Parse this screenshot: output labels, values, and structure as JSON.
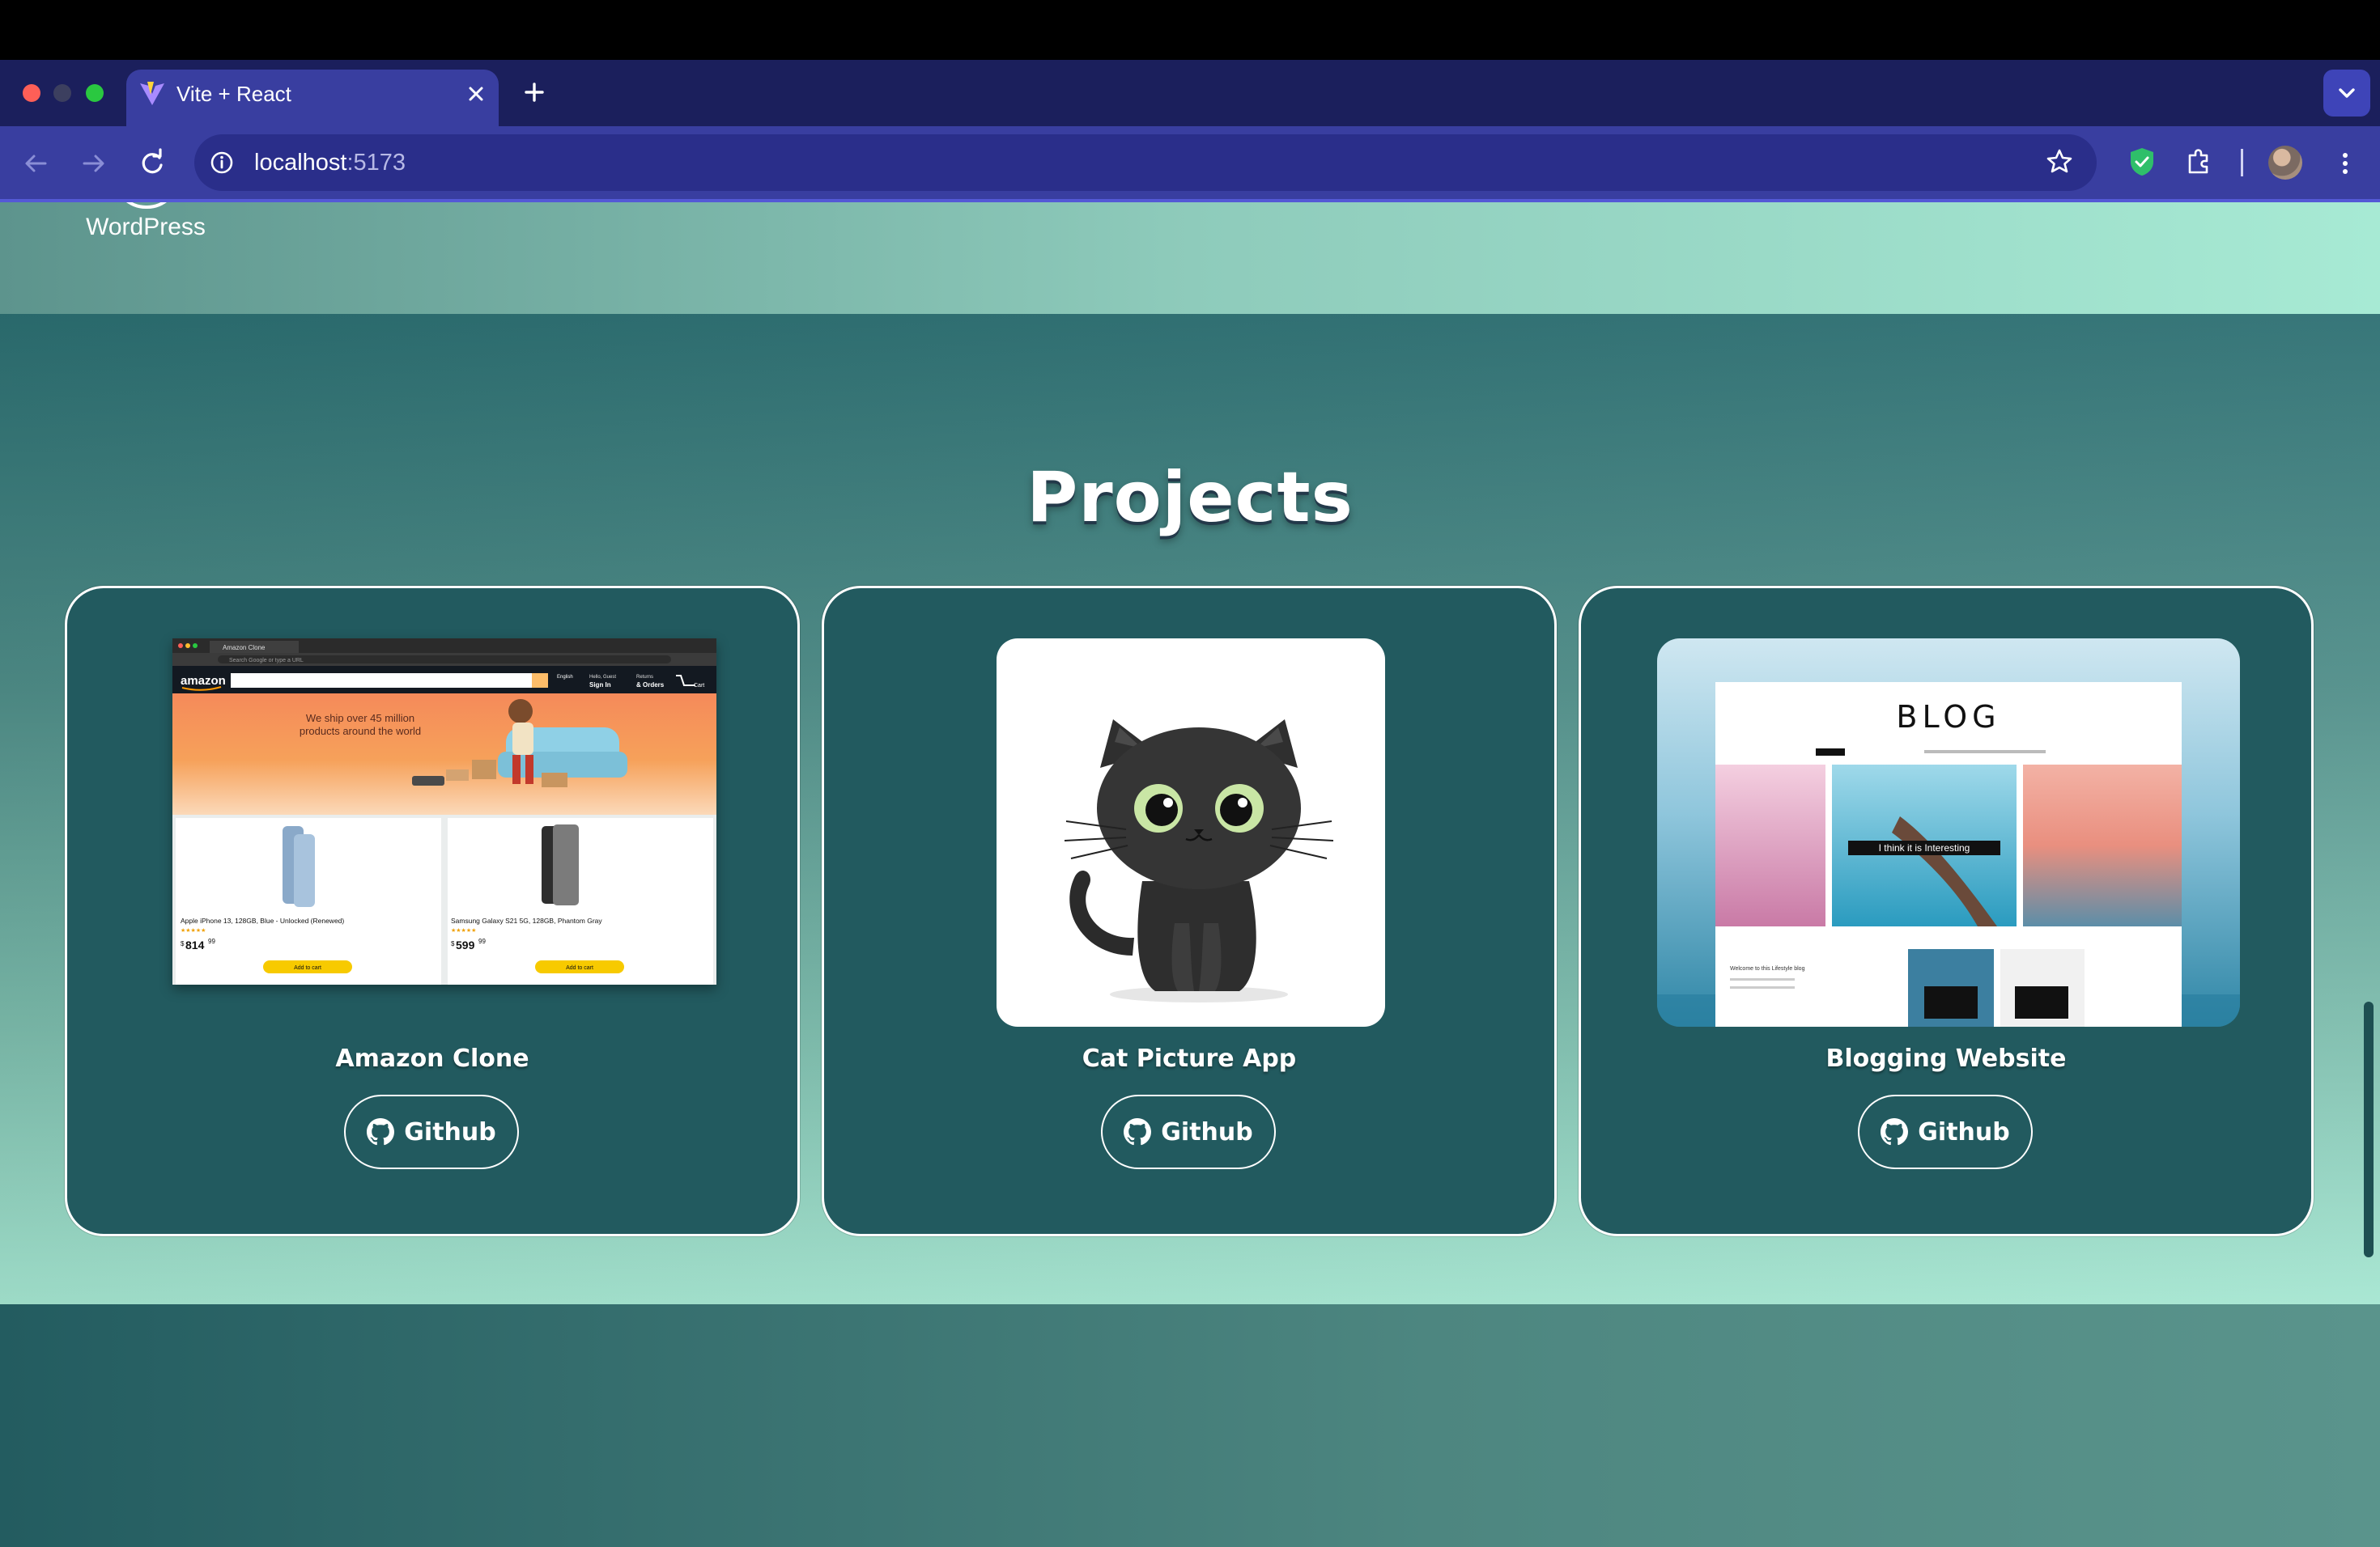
{
  "browser": {
    "tab_title": "Vite + React",
    "url_host": "localhost",
    "url_port": ":5173"
  },
  "skills": {
    "last_item_label": "WordPress"
  },
  "projects": {
    "title": "Projects",
    "items": [
      {
        "title": "Amazon Clone",
        "button_label": "Github",
        "thumbnail": {
          "tab_label": "Amazon Clone",
          "address_placeholder": "Search Google or type a URL",
          "logo_text": "amazon",
          "nav_lang": "English",
          "nav_signin_top": "Hello, Guest",
          "nav_signin": "Sign In",
          "nav_returns_top": "Returns",
          "nav_orders": "& Orders",
          "nav_cart": "Cart",
          "banner_line1": "We ship over 45 million",
          "banner_line2": "products around the world",
          "products": [
            {
              "name": "Apple iPhone 13, 128GB, Blue - Unlocked (Renewed)",
              "price_symbol": "$",
              "price": "814",
              "cents": "99",
              "button": "Add to cart"
            },
            {
              "name": "Samsung Galaxy S21 5G, 128GB, Phantom Gray",
              "price_symbol": "$",
              "price": "599",
              "cents": "99",
              "button": "Add to cart"
            }
          ]
        }
      },
      {
        "title": "Cat Picture App",
        "button_label": "Github"
      },
      {
        "title": "Blogging Website",
        "button_label": "Github",
        "thumbnail": {
          "heading": "BLOG",
          "hero_caption": "I think it is Interesting",
          "welcome": "Welcome to this Lifestyle blog"
        }
      }
    ]
  },
  "colors": {
    "tabstrip": "#1b1f5c",
    "toolbar": "#393ea0",
    "card_bg": "#225a5f",
    "accent_mint": "#a7ead4"
  }
}
